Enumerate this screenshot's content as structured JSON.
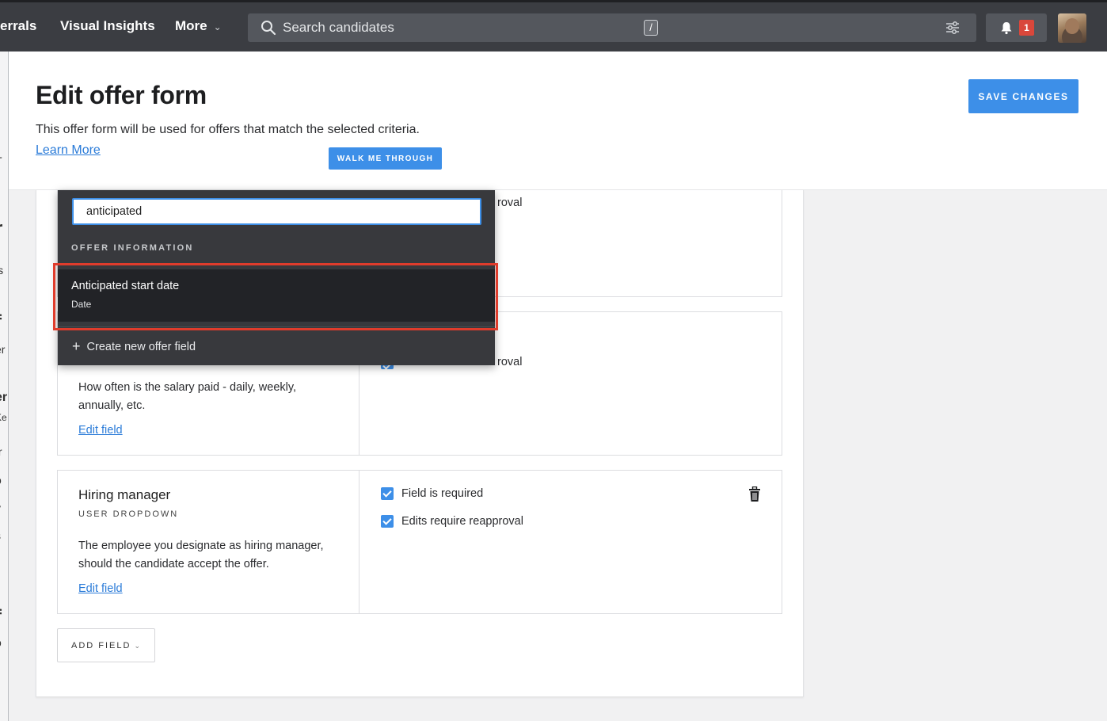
{
  "topnav": {
    "items": [
      {
        "label": "errals"
      },
      {
        "label": "Visual Insights"
      },
      {
        "label": "More",
        "chevron": "⌄"
      }
    ],
    "search": {
      "placeholder": "Search candidates",
      "shortcut": "/"
    },
    "notifications": {
      "count": "1"
    }
  },
  "left_sliver": {
    "glyphs": [
      "T",
      "r",
      "ls",
      "f",
      "er",
      "er",
      "Ke",
      "tr",
      "o",
      "y",
      "s",
      "f",
      "o"
    ]
  },
  "header": {
    "title": "Edit offer form",
    "description": "This offer form will be used for offers that match the selected criteria.",
    "learn_more": "Learn More",
    "walk_me_through": "WALK ME THROUGH",
    "save_changes": "SAVE CHANGES"
  },
  "fields": [
    {
      "partial_label_1": "roval"
    },
    {
      "desc": "How often is the salary paid - daily, weekly, annually, etc.",
      "edit": "Edit field",
      "partial_label_2": "roval"
    },
    {
      "name": "Hiring manager",
      "type": "USER DROPDOWN",
      "desc": "The employee you designate as hiring manager, should the candidate accept the offer.",
      "edit": "Edit field",
      "required_label": "Field is required",
      "reapproval_label": "Edits require reapproval"
    }
  ],
  "add_field": {
    "label": "ADD FIELD",
    "chevron": "⌄"
  },
  "dropdown": {
    "query": "anticipated",
    "section": "OFFER INFORMATION",
    "option": {
      "name": "Anticipated start date",
      "type": "Date"
    },
    "create": "Create new offer field",
    "create_plus": "+"
  },
  "colors": {
    "accent": "#3d8fe8",
    "nav_bg": "#3b3d42",
    "dropdown_bg": "#38393d",
    "highlight": "#e03c2c",
    "badge": "#d9473b"
  }
}
